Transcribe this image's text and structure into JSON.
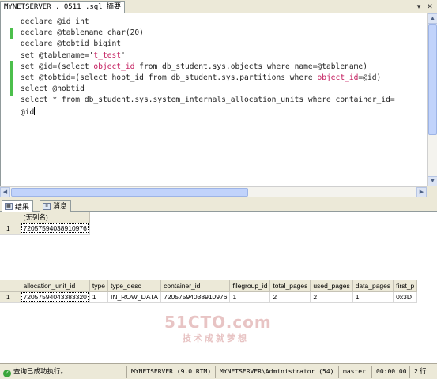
{
  "doc_tab": {
    "label": "MYNETSERVER   .   0511  .sql  摘要"
  },
  "tab_tools": {
    "dropdown": "▾",
    "close": "✕"
  },
  "editor": {
    "lines": [
      {
        "segments": [
          {
            "t": "declare @id int",
            "c": "kw"
          }
        ]
      },
      {
        "segments": [
          {
            "t": "declare @tablename char(20)",
            "c": "kw"
          }
        ]
      },
      {
        "segments": [
          {
            "t": "declare @tobtid bigint",
            "c": "kw"
          }
        ]
      },
      {
        "segments": [
          {
            "t": "set @tablename='",
            "c": "kw"
          },
          {
            "t": "t_test",
            "c": "hl"
          },
          {
            "t": "'",
            "c": "kw"
          }
        ]
      },
      {
        "segments": [
          {
            "t": "set @id=(select ",
            "c": "kw"
          },
          {
            "t": "object_id",
            "c": "hl"
          },
          {
            "t": " from db_student.sys.objects where name=@tablename)",
            "c": "kw"
          }
        ]
      },
      {
        "segments": [
          {
            "t": "set @tobtid=(select hobt_id from db_student.sys.partitions where ",
            "c": "kw"
          },
          {
            "t": "object_id",
            "c": "hl"
          },
          {
            "t": "=@id)",
            "c": "kw"
          }
        ]
      },
      {
        "segments": [
          {
            "t": "select @hobtid",
            "c": "kw"
          }
        ]
      },
      {
        "segments": [
          {
            "t": "select * from db_student.sys.system_internals_allocation_units where container_id=",
            "c": "kw"
          }
        ]
      },
      {
        "segments": [
          {
            "t": "@id",
            "c": "kw"
          }
        ],
        "caret": true
      }
    ]
  },
  "results_tabs": [
    {
      "label": "结果",
      "icon": "grid-icon",
      "active": true
    },
    {
      "label": "消息",
      "icon": "message-icon",
      "active": false
    }
  ],
  "grid1": {
    "headers": [
      "(无列名)"
    ],
    "rows": [
      {
        "num": "1",
        "cells": [
          "72057594038910976"
        ]
      }
    ]
  },
  "grid2": {
    "headers": [
      "allocation_unit_id",
      "type",
      "type_desc",
      "container_id",
      "filegroup_id",
      "total_pages",
      "used_pages",
      "data_pages",
      "first_p"
    ],
    "rows": [
      {
        "num": "1",
        "cells": [
          "72057594043383320",
          "1",
          "IN_ROW_DATA",
          "72057594038910976",
          "1",
          "2",
          "2",
          "1",
          "0x3D"
        ]
      }
    ]
  },
  "watermark": {
    "big": "51CTO.com",
    "small": "技术成就梦想"
  },
  "statusbar": {
    "message": "查询已成功执行。",
    "server": "MYNETSERVER (9.0 RTM)",
    "login": "MYNETSERVER\\Administrator (54)",
    "database": "master",
    "elapsed": "00:00:00",
    "rows": "2 行"
  }
}
